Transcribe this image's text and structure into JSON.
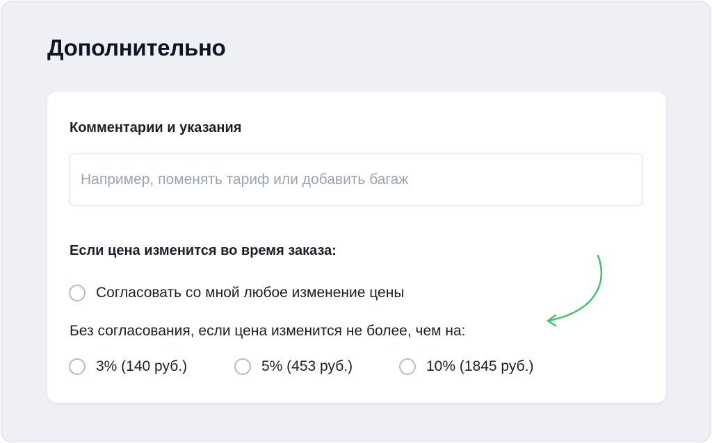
{
  "page": {
    "title": "Дополнительно"
  },
  "comments": {
    "label": "Комментарии и указания",
    "value": "",
    "placeholder": "Например, поменять тариф или добавить багаж"
  },
  "price_change": {
    "label": "Если цена изменится во время заказа:",
    "agree_any_option": "Согласовать со мной любое изменение цены",
    "no_agreement_label": "Без согласования, если цена изменится не более, чем на:",
    "options": [
      {
        "label": "3% (140 руб.)",
        "selected": false
      },
      {
        "label": "5% (453 руб.)",
        "selected": false
      },
      {
        "label": "10% (1845 руб.)",
        "selected": false
      }
    ]
  },
  "colors": {
    "background": "#eff0f5",
    "card": "#ffffff",
    "hint_arrow": "#3ec46d"
  },
  "icons": {
    "hint": "curved-arrow-icon"
  }
}
